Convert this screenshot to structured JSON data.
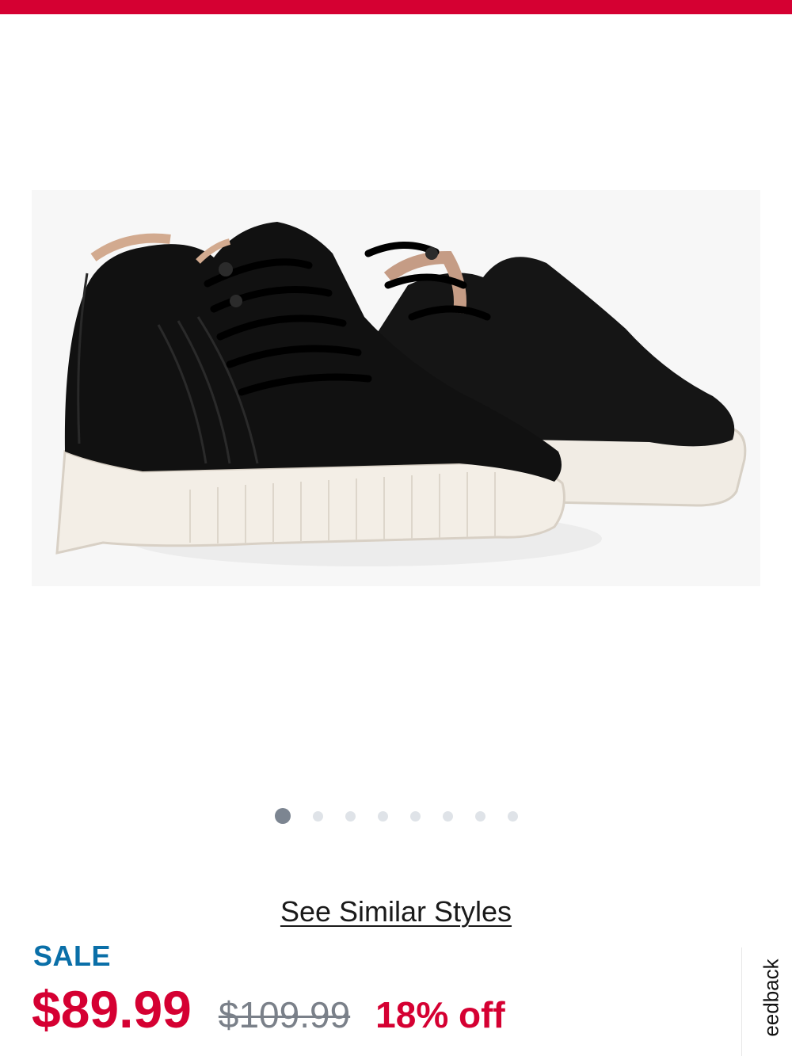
{
  "colors": {
    "accent_red": "#d50032",
    "sale_blue": "#0a6fa8",
    "dot_active": "#7c8591",
    "dot_inactive": "#dfe3e8"
  },
  "product": {
    "image_alt": "product-image",
    "carousel": {
      "count": 8,
      "active_index": 0
    },
    "see_similar_label": "See Similar Styles",
    "sale_label": "SALE",
    "price_current": "$89.99",
    "price_original": "$109.99",
    "discount": "18% off"
  },
  "feedback_tab": {
    "label": "eedback"
  }
}
